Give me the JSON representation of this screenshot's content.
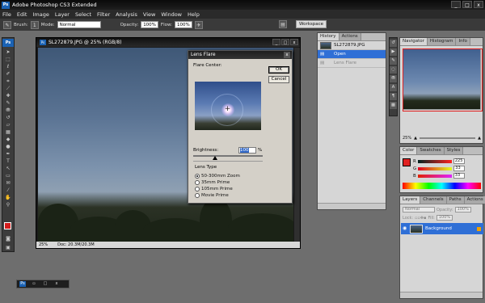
{
  "app": {
    "title": "Adobe Photoshop CS3 Extended",
    "logo": "Ps",
    "window_controls": [
      "_",
      "□",
      "x"
    ]
  },
  "menu": [
    "File",
    "Edit",
    "Image",
    "Layer",
    "Select",
    "Filter",
    "Analysis",
    "View",
    "Window",
    "Help"
  ],
  "options": {
    "brush_label": "Brush:",
    "brush_size": "1",
    "mode_label": "Mode:",
    "mode_value": "Normal",
    "opacity_label": "Opacity:",
    "opacity_value": "100%",
    "flow_label": "Flow:",
    "flow_value": "100%",
    "workspace_label": "Workspace"
  },
  "document": {
    "title": "SL272879.JPG @ 25% (RGB/8)",
    "zoom": "25%",
    "doc_info": "Doc: 20.3M/20.3M"
  },
  "lens_flare": {
    "title": "Lens Flare",
    "flare_center_label": "Flare Center:",
    "ok_label": "OK",
    "cancel_label": "Cancel",
    "brightness_label": "Brightness:",
    "brightness_value": "100",
    "percent": "%",
    "brightness_fraction": 0.33,
    "lens_type_label": "Lens Type",
    "lens_types": [
      "50-300mm Zoom",
      "35mm Prime",
      "105mm Prime",
      "Movie Prime"
    ],
    "selected_lens": "50-300mm Zoom"
  },
  "history": {
    "tabs": [
      "History",
      "Actions"
    ],
    "snapshot": "SL272879.JPG",
    "items": [
      "Open",
      "Lens Flare"
    ]
  },
  "navigator": {
    "tabs": [
      "Navigator",
      "Histogram",
      "Info"
    ],
    "zoom": "25%"
  },
  "color": {
    "tabs": [
      "Color",
      "Swatches",
      "Styles"
    ],
    "R": {
      "label": "R",
      "value": "225"
    },
    "G": {
      "label": "G",
      "value": "33"
    },
    "B": {
      "label": "B",
      "value": "33"
    },
    "fg_color": "#e12121"
  },
  "layers": {
    "tabs": [
      "Layers",
      "Channels",
      "Paths",
      "Actions"
    ],
    "blend_mode": "Normal",
    "opacity_label": "Opacity:",
    "opacity_value": "100%",
    "lock_label": "Lock:",
    "fill_label": "Fill:",
    "fill_value": "100%",
    "layer_name": "Background"
  },
  "toolbox": {
    "logo": "Ps",
    "tools": [
      "move-tool",
      "marquee-tool",
      "lasso-tool",
      "quick-select-tool",
      "crop-tool",
      "eyedropper-tool",
      "healing-tool",
      "brush-tool",
      "clone-stamp-tool",
      "history-brush-tool",
      "eraser-tool",
      "gradient-tool",
      "blur-tool",
      "dodge-tool",
      "pen-tool",
      "type-tool",
      "path-select-tool",
      "shape-tool",
      "notes-tool",
      "hand-tool",
      "zoom-tool"
    ],
    "fg_color": "#d41d1d",
    "bg_color": "#ffffff"
  }
}
